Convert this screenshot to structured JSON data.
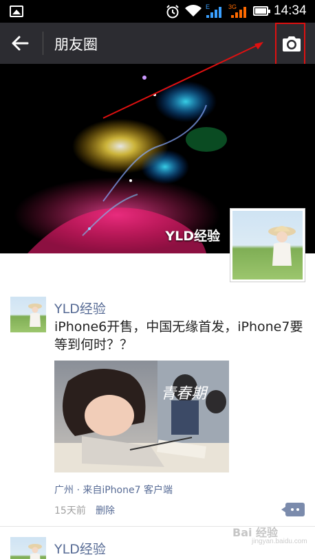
{
  "status_bar": {
    "time": "14:34",
    "net_label_1": "E",
    "net_label_2": "3G",
    "icons": [
      "image-notification-icon",
      "alarm-icon",
      "wifi-icon",
      "signal-icon",
      "battery-icon"
    ]
  },
  "action_bar": {
    "title": "朋友圈",
    "back_icon": "arrow-left",
    "camera_icon": "camera"
  },
  "cover": {
    "name": "YLD经验"
  },
  "posts": [
    {
      "author": "YLD经验",
      "text": "iPhone6开售，中国无缘首发，iPhone7要等到何时？？",
      "image_text": "青春期",
      "location": "广州 · 来自iPhone7 客户端",
      "time": "15天前",
      "delete_label": "删除"
    },
    {
      "author": "YLD经验"
    }
  ],
  "watermark": {
    "main": "Bai 经验",
    "sub": "jingyan.baidu.com"
  },
  "colors": {
    "action_bar": "#2c2c31",
    "link": "#576b95",
    "annotation": "#e01010"
  }
}
